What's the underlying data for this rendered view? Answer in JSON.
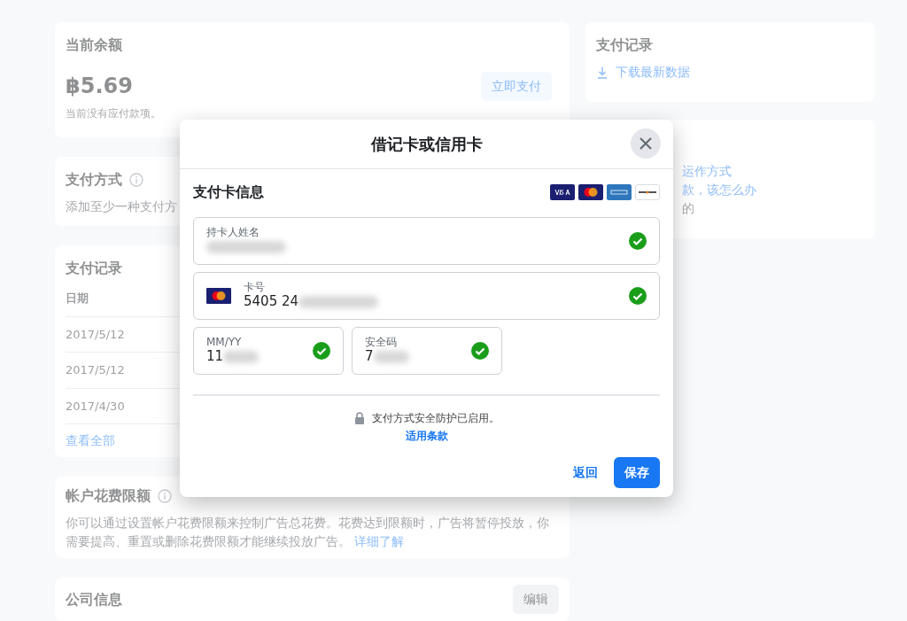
{
  "background": {
    "balance_card": {
      "title": "当前余额",
      "amount": "฿5.69",
      "note": "当前没有应付款项。",
      "pay_button": "立即支付"
    },
    "payment_method_card": {
      "title": "支付方式",
      "note": "添加至少一种支付方"
    },
    "payment_history_card": {
      "title": "支付记录",
      "columns": [
        "日期"
      ],
      "rows": [
        [
          "2017/5/12"
        ],
        [
          "2017/5/12"
        ],
        [
          "2017/4/30"
        ]
      ],
      "view_all": "查看全部"
    },
    "spend_limit_card": {
      "title": "帐户花费限额",
      "text": "你可以通过设置帐户花费限额来控制广告总花费。花费达到限额时，广告将暂停投放，你需要提高、重置或删除花费限额才能继续投放广告。",
      "link": "详细了解"
    },
    "company_card": {
      "title": "公司信息",
      "edit_button": "编辑"
    },
    "side_history_card": {
      "title": "支付记录",
      "download_link": "下载最新数据"
    },
    "help_card": {
      "links": [
        "运作方式",
        "款，该怎么办"
      ],
      "note": "的"
    }
  },
  "dialog": {
    "title": "借记卡或信用卡",
    "section_title": "支付卡信息",
    "fields": [
      {
        "kind": "text",
        "label": "持卡人姓名",
        "valid": true,
        "redacted": true
      },
      {
        "kind": "card-number",
        "label": "卡号",
        "value": "5405 24",
        "valid": true,
        "redacted": true
      },
      {
        "kind": "short",
        "label": "MM/YY",
        "value": "11",
        "valid": true,
        "redacted": true
      },
      {
        "kind": "short",
        "label": "安全码",
        "value": "7",
        "valid": true,
        "redacted": true
      }
    ],
    "security_note": "支付方式安全防护已启用。",
    "terms_link": "适用条款",
    "back_button": "返回",
    "save_button": "保存"
  }
}
